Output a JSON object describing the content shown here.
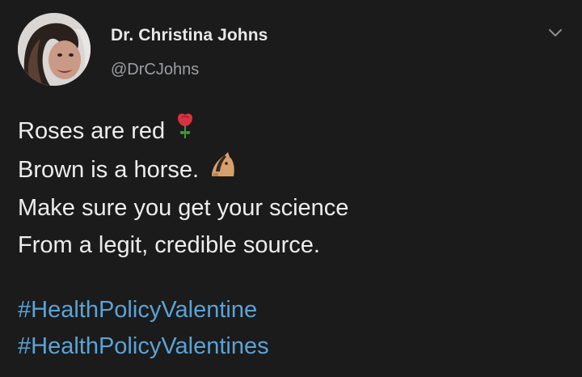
{
  "author": {
    "display_name": "Dr. Christina Johns",
    "handle": "@DrCJohns"
  },
  "tweet": {
    "lines": [
      "Roses are red",
      "Brown is a horse.",
      "Make sure you get your science",
      "From a legit, credible source."
    ],
    "emojis": [
      "rose-icon",
      "horse-icon"
    ],
    "hashtags": [
      "#HealthPolicyValentine",
      "#HealthPolicyValentines"
    ]
  },
  "icons": {
    "menu": "chevron-down-icon"
  },
  "colors": {
    "background": "#1b1b1b",
    "text": "#ededed",
    "secondary_text": "#9a9fa4",
    "link": "#5aa3d6"
  }
}
